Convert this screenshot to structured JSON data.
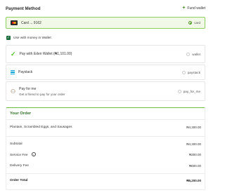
{
  "payment": {
    "title": "Payment Method",
    "fund_wallet_label": "Fund wallet"
  },
  "methods": {
    "card": {
      "label": "Card ... 9162",
      "value": "card",
      "icon": "mastercard-icon",
      "selected": true
    },
    "use_wallet_money": {
      "label": "Use with money in Wallet",
      "checked": true
    },
    "wallet": {
      "label": "Pay with Eden Wallet (₦1,101.00)",
      "value": "wallet",
      "icon": "checkmark-icon"
    },
    "paystack": {
      "label": "Paystack",
      "value": "paystack",
      "icon": "paystack-icon"
    },
    "pay_for_me": {
      "label": "Pay for me",
      "sublabel": "Get a friend to pay for your order",
      "value": "pay_for_me",
      "icon": "person-icon"
    }
  },
  "order": {
    "title": "Your Order",
    "item": {
      "name": "Plantain, Scrambled Eggs, and Sausages",
      "price": "₦4,300.00"
    },
    "subtotal": {
      "label": "Subtotal",
      "value": "₦4,300.00"
    },
    "service_fee": {
      "label": "Service Fee",
      "value": "₦300.00"
    },
    "delivery_fee": {
      "label": "Delivery Fee",
      "value": "₦600.00"
    },
    "total": {
      "label": "Order Total",
      "value": "₦5,200.00"
    }
  },
  "colors": {
    "accent": "#4c9a24",
    "selected_bg": "#f1f8e7",
    "title_green": "#2f6f24"
  }
}
